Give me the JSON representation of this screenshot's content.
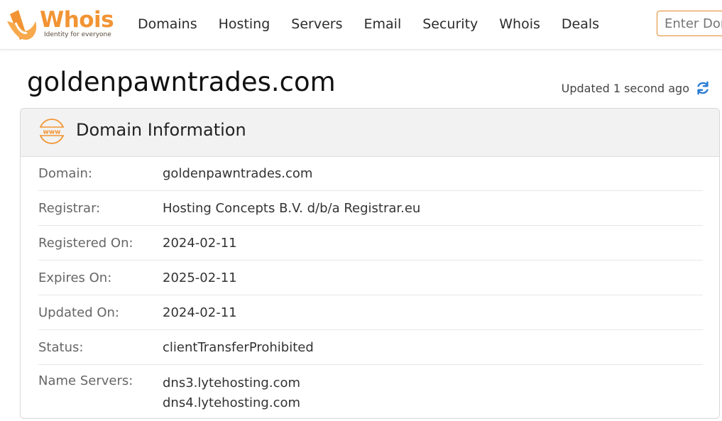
{
  "logo": {
    "word": "Whois",
    "tagline": "Identity for everyone"
  },
  "nav": [
    "Domains",
    "Hosting",
    "Servers",
    "Email",
    "Security",
    "Whois",
    "Deals"
  ],
  "search": {
    "placeholder": "Enter Domain"
  },
  "page": {
    "title": "goldenpawntrades.com",
    "updated": "Updated 1 second ago"
  },
  "panel": {
    "title": "Domain Information",
    "rows": [
      {
        "label": "Domain:",
        "value": "goldenpawntrades.com"
      },
      {
        "label": "Registrar:",
        "value": "Hosting Concepts B.V. d/b/a Registrar.eu"
      },
      {
        "label": "Registered On:",
        "value": "2024-02-11"
      },
      {
        "label": "Expires On:",
        "value": "2025-02-11"
      },
      {
        "label": "Updated On:",
        "value": "2024-02-11"
      },
      {
        "label": "Status:",
        "value": "clientTransferProhibited"
      }
    ],
    "name_servers": {
      "label": "Name Servers:",
      "values": [
        "dns3.lytehosting.com",
        "dns4.lytehosting.com"
      ]
    }
  },
  "colors": {
    "brand": "#f29433",
    "refresh": "#2a7bd4"
  }
}
